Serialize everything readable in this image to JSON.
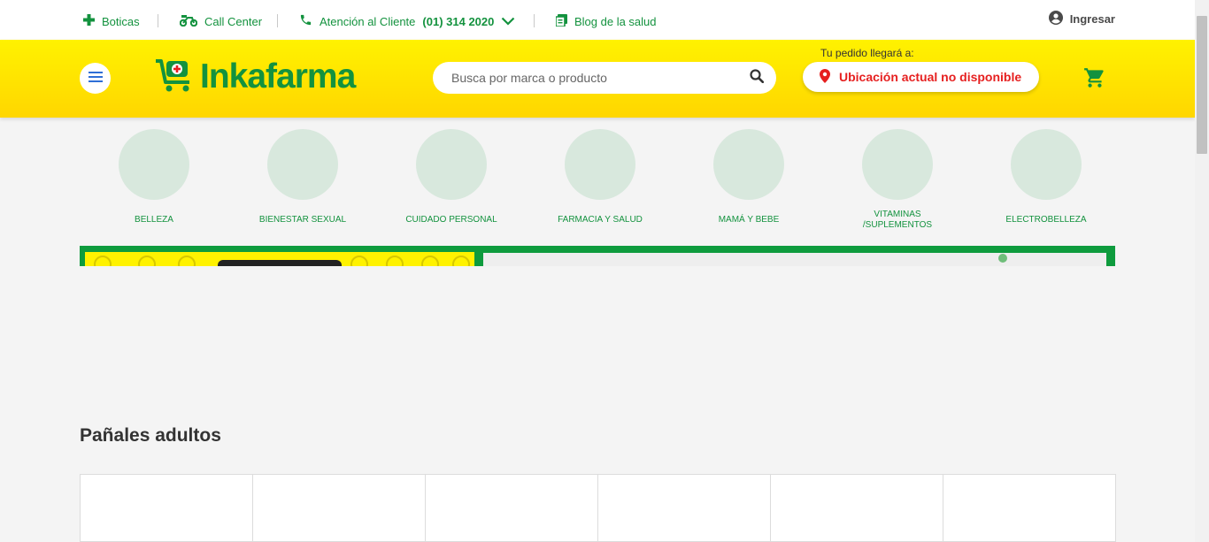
{
  "topbar": {
    "boticas": "Boticas",
    "call_center": "Call Center",
    "atencion_prefix": "Atención al Cliente",
    "atencion_phone": "(01) 314 2020",
    "blog": "Blog de la salud",
    "login": "Ingresar"
  },
  "header": {
    "logo_text": "Inkafarma",
    "search_placeholder": "Busca por marca o producto",
    "delivery_label": "Tu pedido llegará a:",
    "location_text": "Ubicación actual no disponible"
  },
  "categories": [
    {
      "label": "BELLEZA"
    },
    {
      "label": "BIENESTAR SEXUAL"
    },
    {
      "label": "CUIDADO PERSONAL"
    },
    {
      "label": "FARMACIA Y SALUD"
    },
    {
      "label": "MAMÁ Y BEBE"
    },
    {
      "label": "VITAMINAS /SUPLEMENTOS"
    },
    {
      "label": "ELECTROBELLEZA"
    }
  ],
  "section": {
    "title": "Pañales adultos"
  },
  "colors": {
    "brand_green": "#13923e",
    "brand_yellow": "#ffe800",
    "alert_red": "#e62020"
  },
  "icons": [
    "plus-icon",
    "bike-icon",
    "phone-icon",
    "chevron-down-icon",
    "blog-icon",
    "account-icon",
    "menu-icon",
    "cart-logo-icon",
    "search-icon",
    "location-pin-icon",
    "shopping-cart-icon"
  ]
}
